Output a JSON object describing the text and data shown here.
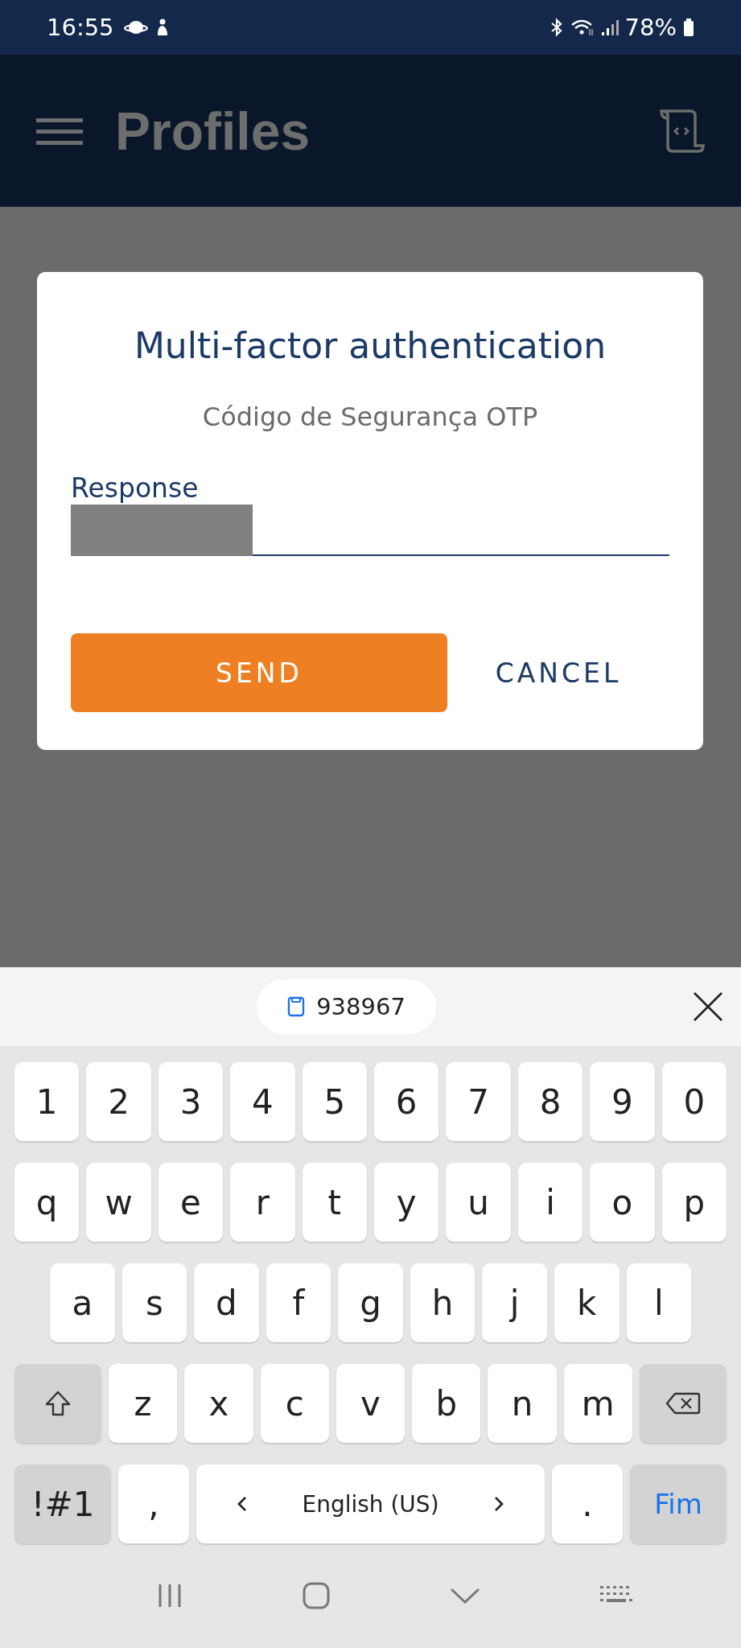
{
  "status_bar": {
    "time": "16:55",
    "battery": "78%"
  },
  "app_bar": {
    "title": "Profiles"
  },
  "dialog": {
    "title": "Multi-factor authentication",
    "message": "Código de Segurança OTP",
    "field": {
      "label": "Response"
    },
    "buttons": [
      {
        "label": "SEND",
        "kind": "primary"
      },
      {
        "label": "CANCEL",
        "kind": "text"
      }
    ]
  },
  "keyboard": {
    "clipboard_suggestion": "938967",
    "rows": [
      [
        {
          "label": "1"
        },
        {
          "label": "2"
        },
        {
          "label": "3"
        },
        {
          "label": "4"
        },
        {
          "label": "5"
        },
        {
          "label": "6"
        },
        {
          "label": "7"
        },
        {
          "label": "8"
        },
        {
          "label": "9"
        },
        {
          "label": "0"
        }
      ],
      [
        {
          "label": "q"
        },
        {
          "label": "w"
        },
        {
          "label": "e"
        },
        {
          "label": "r"
        },
        {
          "label": "t"
        },
        {
          "label": "y"
        },
        {
          "label": "u"
        },
        {
          "label": "i"
        },
        {
          "label": "o"
        },
        {
          "label": "p"
        }
      ],
      [
        {
          "label": "a"
        },
        {
          "label": "s"
        },
        {
          "label": "d"
        },
        {
          "label": "f"
        },
        {
          "label": "g"
        },
        {
          "label": "h"
        },
        {
          "label": "j"
        },
        {
          "label": "k"
        },
        {
          "label": "l"
        }
      ],
      [
        {
          "kind": "shift"
        },
        {
          "label": "z"
        },
        {
          "label": "x"
        },
        {
          "label": "c"
        },
        {
          "label": "v"
        },
        {
          "label": "b"
        },
        {
          "label": "n"
        },
        {
          "label": "m"
        },
        {
          "kind": "backspace"
        }
      ]
    ],
    "bottom_bar": {
      "symbols_key": "!#1",
      "comma_key": ",",
      "space_key": "English (US)",
      "period_key": ".",
      "action_key": "Fim"
    }
  }
}
